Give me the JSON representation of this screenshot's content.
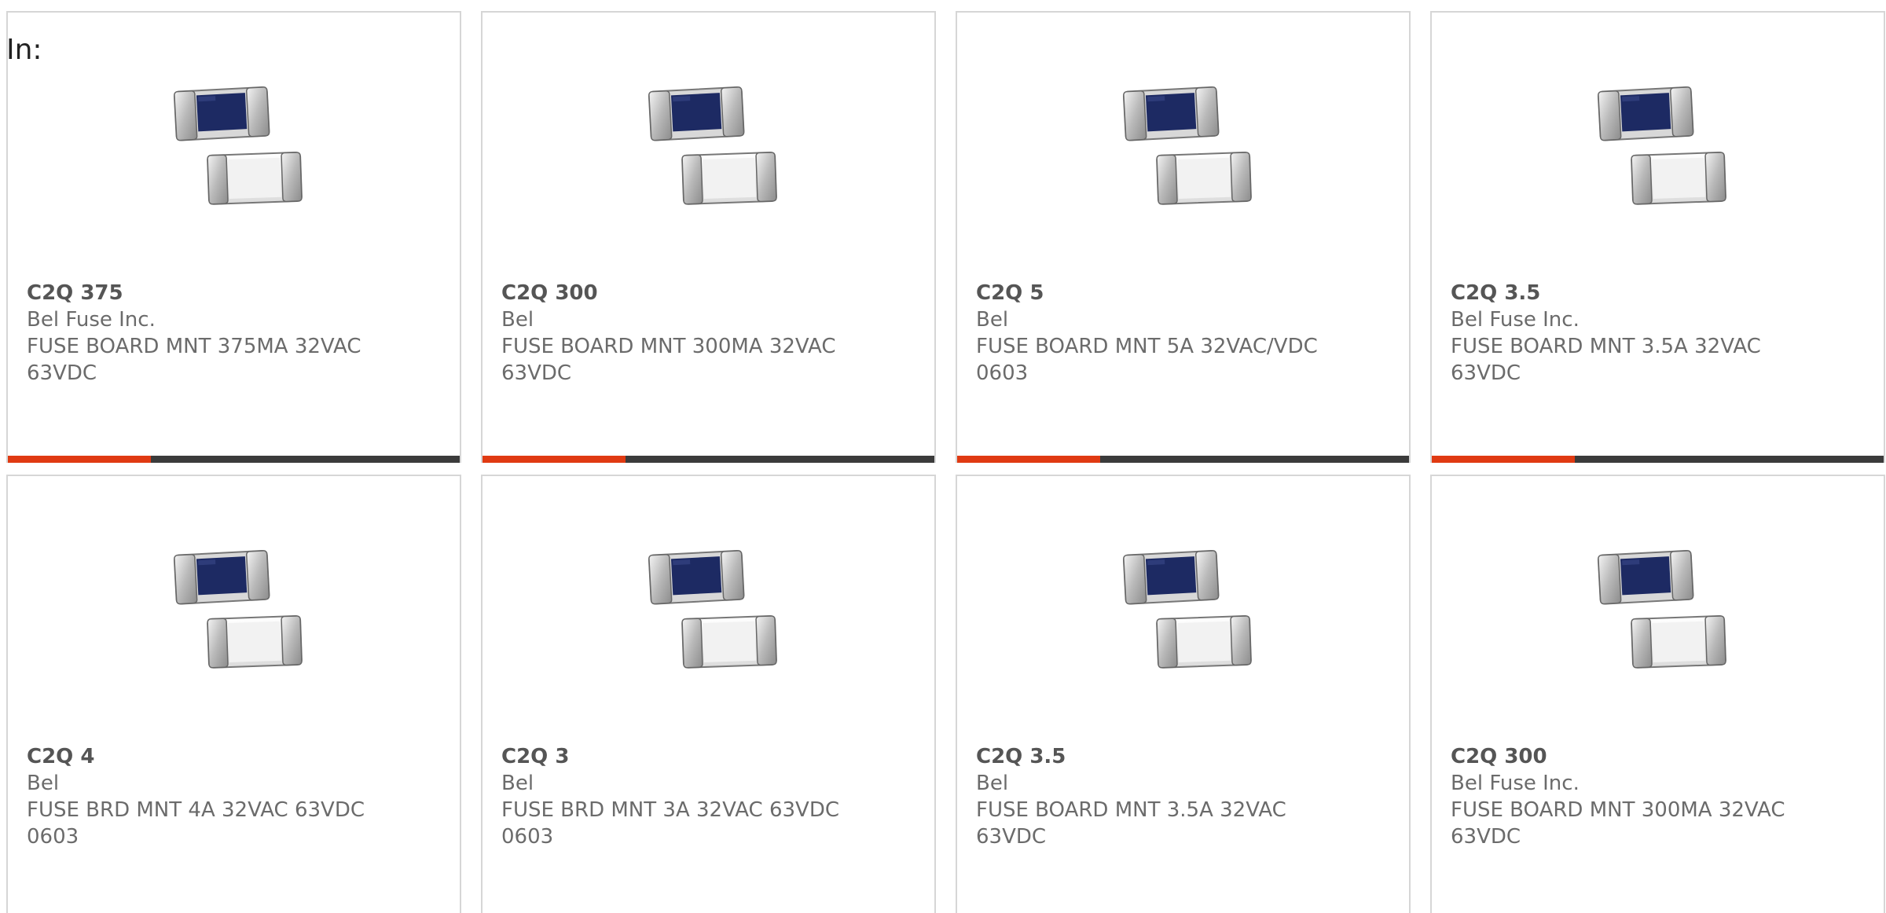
{
  "filter_label": "In:",
  "colors": {
    "accent": "#e03a12",
    "bar_dark": "#3b3b3b",
    "border": "#d6d6d6",
    "text": "#6b6b6b"
  },
  "products": [
    {
      "part": "C2Q 375",
      "manufacturer": "Bel Fuse Inc.",
      "description": "FUSE BOARD MNT 375MA 32VAC 63VDC",
      "image_icon": "smd-fuse-image"
    },
    {
      "part": "C2Q 300",
      "manufacturer": "Bel",
      "description": "FUSE BOARD MNT 300MA 32VAC 63VDC",
      "image_icon": "smd-fuse-image"
    },
    {
      "part": "C2Q 5",
      "manufacturer": "Bel",
      "description": "FUSE BOARD MNT 5A 32VAC/VDC 0603",
      "image_icon": "smd-fuse-image"
    },
    {
      "part": "C2Q 3.5",
      "manufacturer": "Bel Fuse Inc.",
      "description": "FUSE BOARD MNT 3.5A 32VAC 63VDC",
      "image_icon": "smd-fuse-image"
    },
    {
      "part": "C2Q 4",
      "manufacturer": "Bel",
      "description": "FUSE BRD MNT 4A 32VAC 63VDC 0603",
      "image_icon": "smd-fuse-image"
    },
    {
      "part": "C2Q 3",
      "manufacturer": "Bel",
      "description": "FUSE BRD MNT 3A 32VAC 63VDC 0603",
      "image_icon": "smd-fuse-image"
    },
    {
      "part": "C2Q 3.5",
      "manufacturer": "Bel",
      "description": "FUSE BOARD MNT 3.5A 32VAC 63VDC",
      "image_icon": "smd-fuse-image"
    },
    {
      "part": "C2Q 300",
      "manufacturer": "Bel Fuse Inc.",
      "description": "FUSE BOARD MNT 300MA 32VAC 63VDC",
      "image_icon": "smd-fuse-image"
    }
  ]
}
